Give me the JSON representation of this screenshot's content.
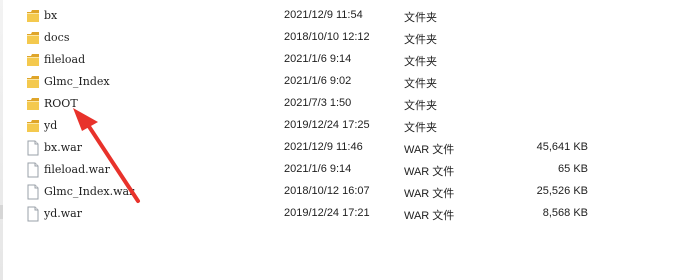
{
  "files": [
    {
      "name": "bx",
      "modified": "2021/12/9 11:54",
      "type": "文件夹",
      "size": "",
      "icon": "folder-icon"
    },
    {
      "name": "docs",
      "modified": "2018/10/10 12:12",
      "type": "文件夹",
      "size": "",
      "icon": "folder-icon"
    },
    {
      "name": "fileload",
      "modified": "2021/1/6 9:14",
      "type": "文件夹",
      "size": "",
      "icon": "folder-icon"
    },
    {
      "name": "Glmc_Index",
      "modified": "2021/1/6 9:02",
      "type": "文件夹",
      "size": "",
      "icon": "folder-icon"
    },
    {
      "name": "ROOT",
      "modified": "2021/7/3 1:50",
      "type": "文件夹",
      "size": "",
      "icon": "folder-icon"
    },
    {
      "name": "yd",
      "modified": "2019/12/24 17:25",
      "type": "文件夹",
      "size": "",
      "icon": "folder-icon"
    },
    {
      "name": "bx.war",
      "modified": "2021/12/9 11:46",
      "type": "WAR 文件",
      "size": "45,641 KB",
      "icon": "file-icon"
    },
    {
      "name": "fileload.war",
      "modified": "2021/1/6 9:14",
      "type": "WAR 文件",
      "size": "65 KB",
      "icon": "file-icon"
    },
    {
      "name": "Glmc_Index.war",
      "modified": "2018/10/12 16:07",
      "type": "WAR 文件",
      "size": "25,526 KB",
      "icon": "file-icon"
    },
    {
      "name": "yd.war",
      "modified": "2019/12/24 17:21",
      "type": "WAR 文件",
      "size": "8,568 KB",
      "icon": "file-icon"
    }
  ],
  "annotation": {
    "target": "ROOT",
    "color": "#e8322b",
    "icon": "arrow-annotation"
  },
  "colors": {
    "folder": "#f4c94e",
    "folder_dark": "#dfa52a",
    "file_outline": "#9aa0a8"
  }
}
